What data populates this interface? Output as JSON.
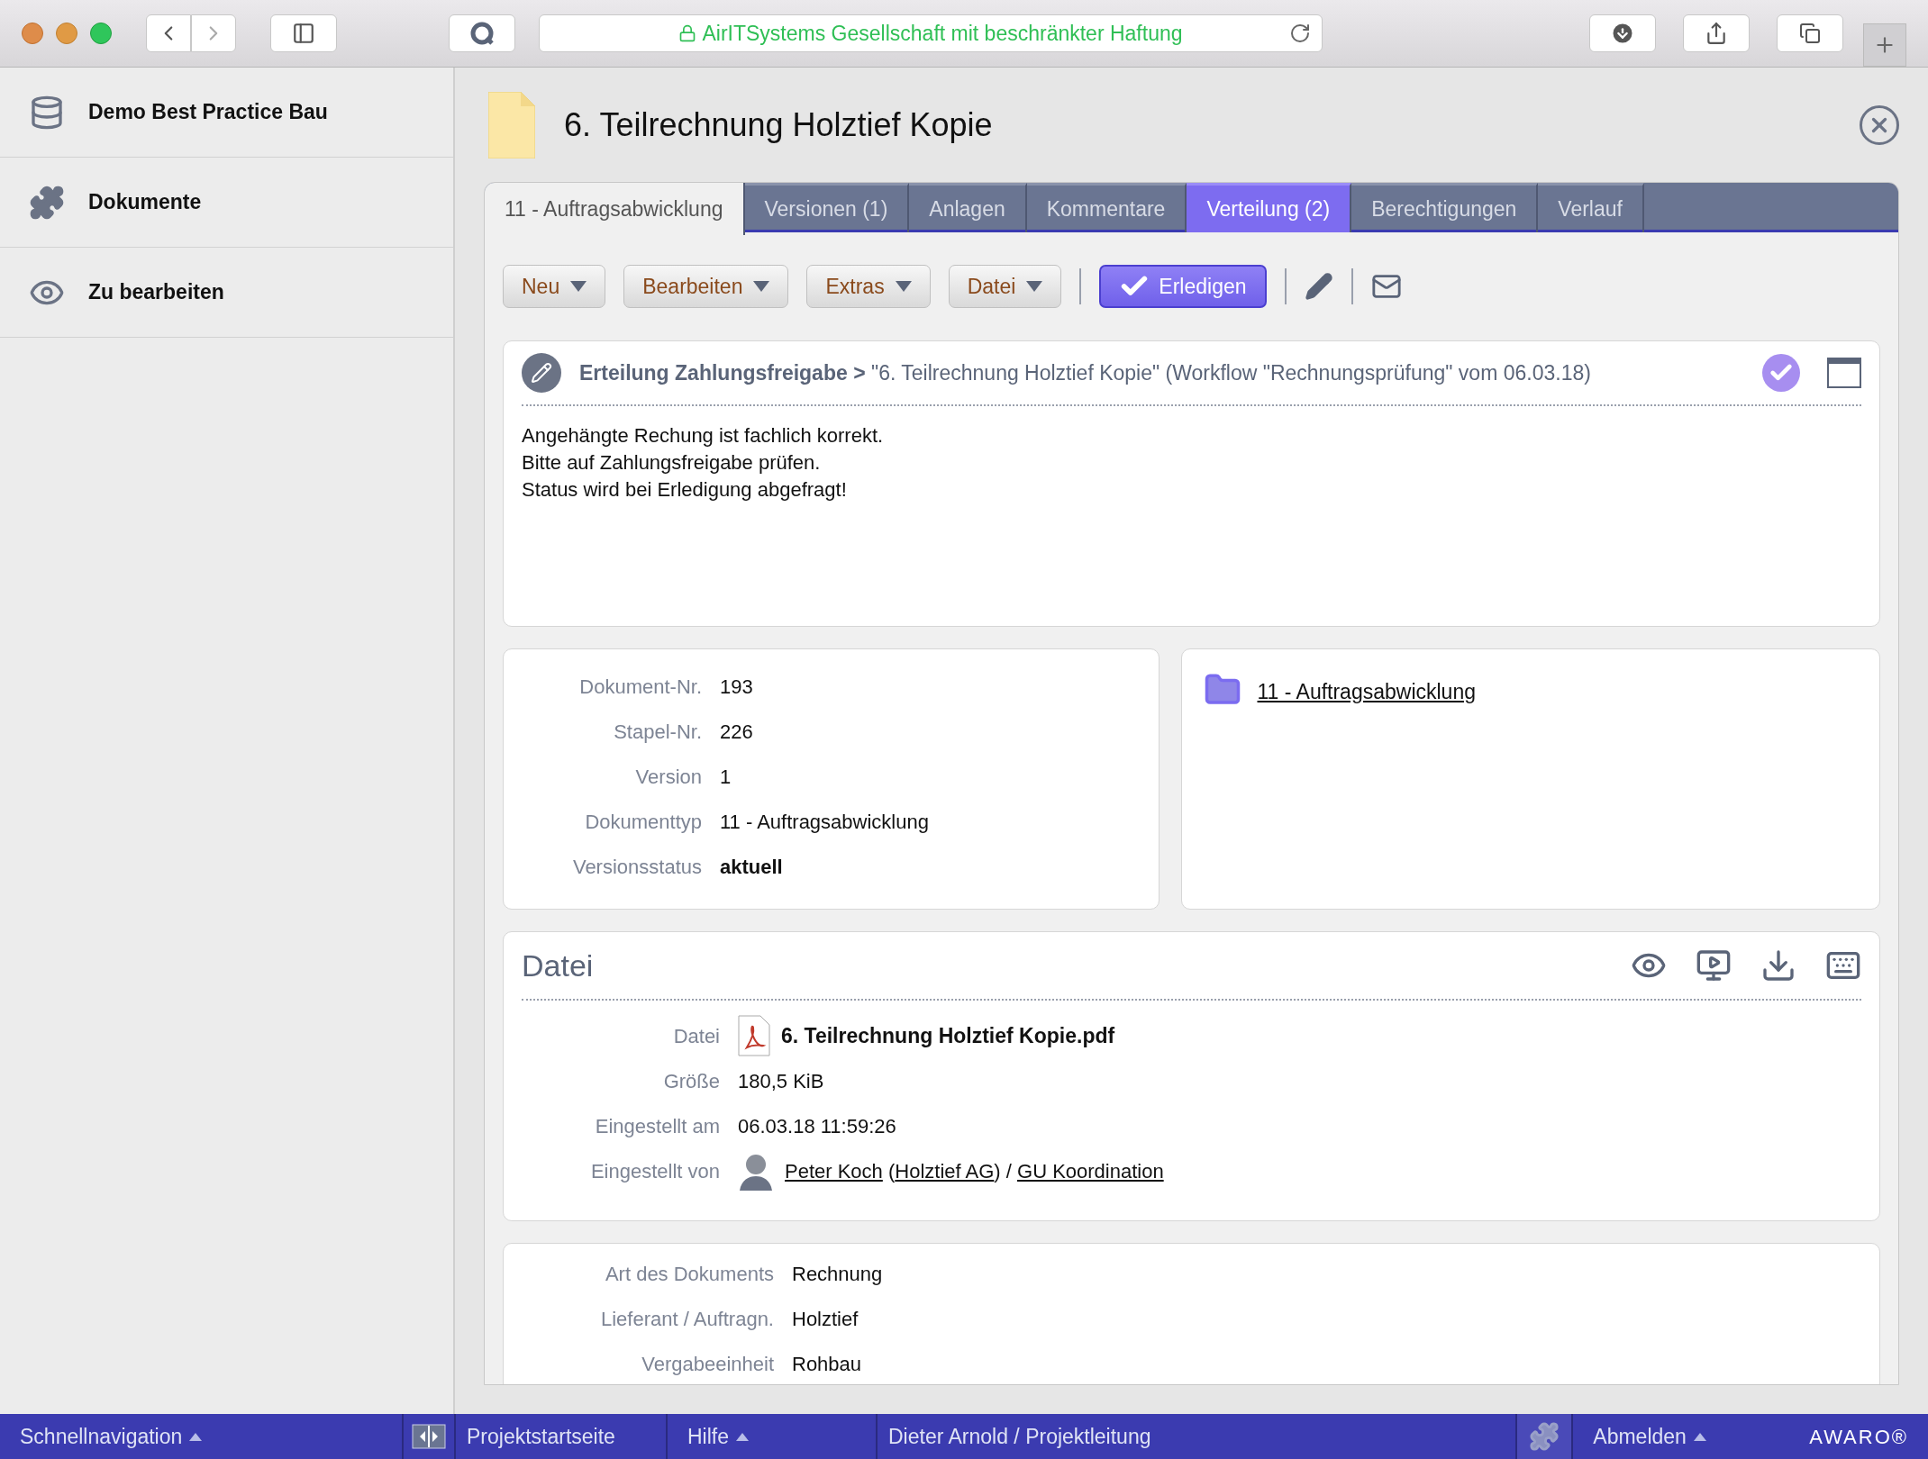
{
  "browser": {
    "address": "AirITSystems Gesellschaft mit beschränkter Haftung"
  },
  "sidebar": {
    "items": [
      {
        "label": "Demo Best Practice Bau",
        "kind": "database"
      },
      {
        "label": "Dokumente",
        "kind": "puzzle"
      },
      {
        "label": "Zu bearbeiten",
        "kind": "eye"
      }
    ]
  },
  "document": {
    "title": "6. Teilrechnung Holztief Kopie"
  },
  "tabs": [
    {
      "label": "11 - Auftragsabwicklung",
      "selected": true,
      "highlighted": false
    },
    {
      "label": "Versionen (1)",
      "selected": false,
      "highlighted": false
    },
    {
      "label": "Anlagen",
      "selected": false,
      "highlighted": false
    },
    {
      "label": "Kommentare",
      "selected": false,
      "highlighted": false
    },
    {
      "label": "Verteilung (2)",
      "selected": false,
      "highlighted": true
    },
    {
      "label": "Berechtigungen",
      "selected": false,
      "highlighted": false
    },
    {
      "label": "Verlauf",
      "selected": false,
      "highlighted": false
    }
  ],
  "toolbar": {
    "menus": [
      "Neu",
      "Bearbeiten",
      "Extras",
      "Datei"
    ],
    "primary": "Erledigen"
  },
  "task": {
    "heading": "**Erteilung Zahlungsfreigabe >** \"6. Teilrechnung Holztief Kopie\" (Workflow \"Rechnungsprüfung\" vom 06.03.18)",
    "done": true,
    "lines": [
      "Angehängte Rechung ist fachlich korrekt.",
      "Bitte auf Zahlungsfreigabe prüfen.",
      "Status wird bei Erledigung abgefragt!"
    ]
  },
  "info": {
    "fields": [
      {
        "label": "Dokument-Nr.",
        "value": "193",
        "emphasized": false
      },
      {
        "label": "Stapel-Nr.",
        "value": "226",
        "emphasized": false
      },
      {
        "label": "Version",
        "value": "1",
        "emphasized": false
      },
      {
        "label": "Dokumenttyp",
        "value": "11 - Auftragsabwicklung",
        "emphasized": false
      },
      {
        "label": "Versionsstatus",
        "value": "aktuell",
        "emphasized": true
      }
    ],
    "folder": "11 - Auftragsabwicklung"
  },
  "file": {
    "title": "Datei",
    "fields": [
      {
        "kind": "file",
        "label": "Datei",
        "value": "6. Teilrechnung Holztief Kopie.pdf"
      },
      {
        "kind": "text",
        "label": "Größe",
        "value": "180,5 KiB"
      },
      {
        "kind": "text",
        "label": "Eingestellt am",
        "value": "06.03.18 11:59:26"
      },
      {
        "kind": "user",
        "label": "Eingestellt von",
        "parts": [
          {
            "text": "Peter Koch",
            "link": true
          },
          {
            "text": " (",
            "link": false
          },
          {
            "text": "Holztief AG",
            "link": true
          },
          {
            "text": ") / ",
            "link": false
          },
          {
            "text": "GU Koordination",
            "link": true
          }
        ]
      }
    ]
  },
  "metadata": {
    "fields": [
      {
        "label": "Art des Dokuments",
        "value": "Rechnung"
      },
      {
        "label": "Lieferant / Auftragn.",
        "value": "Holztief"
      },
      {
        "label": "Vergabeeinheit",
        "value": "Rohbau"
      }
    ]
  },
  "status_bar": {
    "quick_nav": "Schnellnavigation",
    "start": "Projektstartseite",
    "help": "Hilfe",
    "user": "Dieter Arnold / Projektleitung",
    "logout": "Abmelden",
    "logo": "AWARO®"
  }
}
